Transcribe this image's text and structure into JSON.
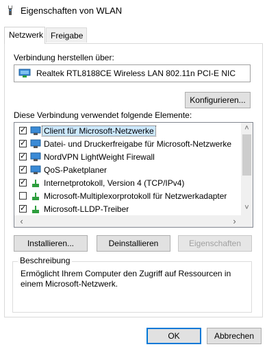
{
  "window": {
    "title": "Eigenschaften von WLAN"
  },
  "tabs": [
    {
      "label": "Netzwerk",
      "active": true
    },
    {
      "label": "Freigabe",
      "active": false
    }
  ],
  "connect_via": {
    "label": "Verbindung herstellen über:",
    "adapter": "Realtek RTL8188CE Wireless LAN 802.11n PCI-E NIC",
    "adapter_icon": "network-adapter-icon",
    "configure_button": "Konfigurieren..."
  },
  "components": {
    "label": "Diese Verbindung verwendet folgende Elemente:",
    "items": [
      {
        "label": "Client für Microsoft-Netzwerke",
        "checked": true,
        "icon": "network-client-icon",
        "selected": true
      },
      {
        "label": "Datei- und Druckerfreigabe für Microsoft-Netzwerke",
        "checked": true,
        "icon": "network-service-icon",
        "selected": false
      },
      {
        "label": "NordVPN LightWeight Firewall",
        "checked": true,
        "icon": "network-service-icon",
        "selected": false
      },
      {
        "label": "QoS-Paketplaner",
        "checked": true,
        "icon": "network-service-icon",
        "selected": false
      },
      {
        "label": "Internetprotokoll, Version 4 (TCP/IPv4)",
        "checked": true,
        "icon": "protocol-icon",
        "selected": false
      },
      {
        "label": "Microsoft-Multiplexorprotokoll für Netzwerkadapter",
        "checked": false,
        "icon": "protocol-icon",
        "selected": false
      },
      {
        "label": "Microsoft-LLDP-Treiber",
        "checked": true,
        "icon": "protocol-icon",
        "selected": false
      }
    ]
  },
  "buttons": {
    "install": "Installieren...",
    "uninstall": "Deinstallieren",
    "properties": "Eigenschaften",
    "ok": "OK",
    "cancel": "Abbrechen"
  },
  "description": {
    "legend": "Beschreibung",
    "text": "Ermöglicht Ihrem Computer den Zugriff auf Ressourcen in einem Microsoft-Netzwerk."
  },
  "colors": {
    "selection": "#cce8ff",
    "focus_border": "#0078d7",
    "service_icon": "#3a8ad6",
    "protocol_icon": "#2e9e3e"
  }
}
